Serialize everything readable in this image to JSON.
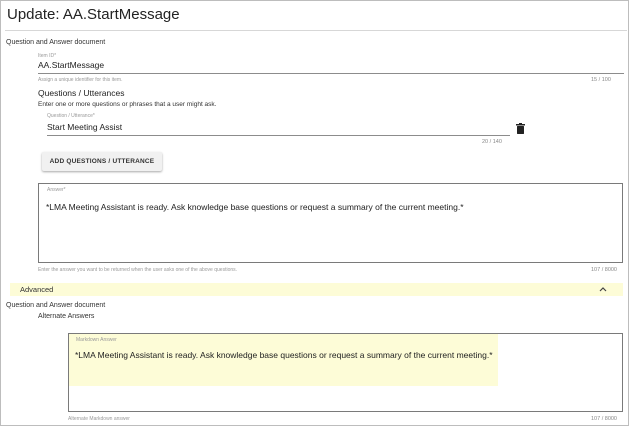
{
  "page_title": "Update: AA.StartMessage",
  "section_label": "Question and Answer document",
  "item_id": {
    "label": "Item ID*",
    "value": "AA.StartMessage",
    "hint": "Assign a unique identifier for this item.",
    "counter": "15 / 100"
  },
  "questions": {
    "heading": "Questions / Utterances",
    "description": "Enter one or more questions or phrases that a user might ask.",
    "field_label": "Question / Utterance*",
    "value": "Start Meeting Assist",
    "counter": "20 / 140",
    "add_button": "ADD QUESTIONS / UTTERANCE"
  },
  "answer": {
    "label": "Answer*",
    "value": "*LMA Meeting Assistant is ready. Ask knowledge base questions or request a summary of the current meeting.*",
    "hint": "Enter the answer you want to be returned when the user asks one of the above questions.",
    "counter": "107 / 8000"
  },
  "advanced": {
    "label": "Advanced",
    "expanded": true,
    "icon": "chevron-up-icon"
  },
  "advanced_section_label": "Question and Answer document",
  "alternate": {
    "heading": "Alternate Answers",
    "markdown_label": "Markdown Answer",
    "markdown_value": "*LMA Meeting Assistant is ready. Ask knowledge base questions or request a summary of the current meeting.*",
    "hint": "Alternate Markdown answer",
    "counter": "107 / 8000"
  },
  "colors": {
    "highlight": "#fdfcd7",
    "border": "#7a7a7a"
  }
}
